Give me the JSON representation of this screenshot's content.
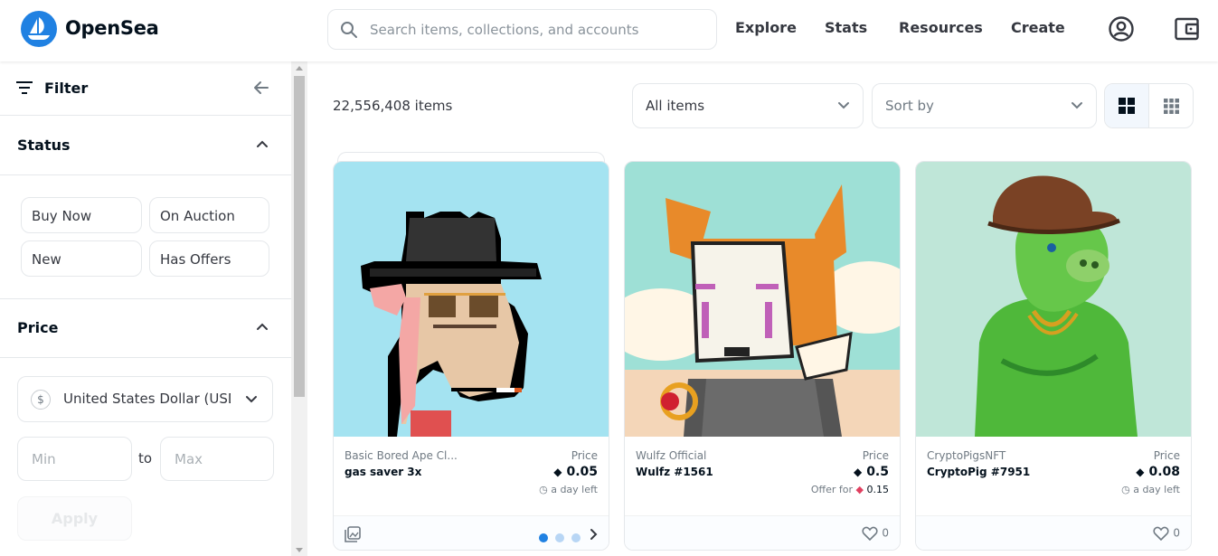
{
  "header": {
    "brand": "OpenSea",
    "search_placeholder": "Search items, collections, and accounts",
    "nav": [
      "Explore",
      "Stats",
      "Resources",
      "Create"
    ],
    "brand_color": "#2081e2"
  },
  "sidebar": {
    "filter_label": "Filter",
    "status": {
      "title": "Status",
      "chips": [
        "Buy Now",
        "On Auction",
        "New",
        "Has Offers"
      ]
    },
    "price": {
      "title": "Price",
      "currency_symbol": "$",
      "currency": "United States Dollar (USD)",
      "min_placeholder": "Min",
      "to_label": "to",
      "max_placeholder": "Max",
      "apply_label": "Apply"
    }
  },
  "main": {
    "item_count": "22,556,408 items",
    "items_filter": "All items",
    "sort_by": "Sort by",
    "cards": [
      {
        "collection": "Basic Bored Ape Cl...",
        "name": "gas saver 3x",
        "price_label": "Price",
        "price": "0.05",
        "sub": "a day left",
        "footer": "carousel"
      },
      {
        "collection": "Wulfz Official",
        "name": "Wulfz #1561",
        "price_label": "Price",
        "price": "0.5",
        "sub_prefix": "Offer for",
        "sub_value": "0.15",
        "favorites": "0"
      },
      {
        "collection": "CryptoPigsNFT",
        "name": "CryptoPig #7951",
        "price_label": "Price",
        "price": "0.08",
        "sub": "a day left",
        "favorites": "0"
      }
    ]
  }
}
